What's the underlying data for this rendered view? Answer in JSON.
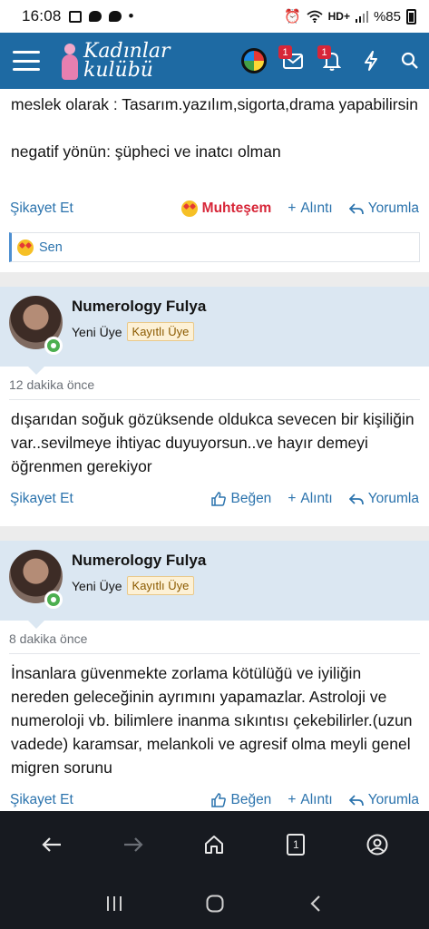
{
  "status": {
    "time": "16:08",
    "network": "HD+",
    "battery": "%85"
  },
  "header": {
    "logo_line1": "Kadınlar",
    "logo_line2": "kulübü",
    "messages_badge": "1",
    "alerts_badge": "1"
  },
  "posts": [
    {
      "text_line1": "meslek olarak : Tasarım.yazılım,sigorta,drama yapabilirsin",
      "text_line2": "negatif yönün: şüpheci ve inatcı olman",
      "report": "Şikayet Et",
      "reaction": "Muhteşem",
      "quote": "Alıntı",
      "reply": "Yorumla",
      "reacted_by": "Sen"
    },
    {
      "author": "Numerology Fulya",
      "title": "Yeni Üye",
      "role": "Kayıtlı Üye",
      "time": "12 dakika önce",
      "text": "dışarıdan soğuk gözüksende oldukca sevecen bir kişiliğin var..sevilmeye ihtiyac duyuyorsun..ve hayır demeyi öğrenmen gerekiyor",
      "report": "Şikayet Et",
      "like": "Beğen",
      "quote": "Alıntı",
      "reply": "Yorumla"
    },
    {
      "author": "Numerology Fulya",
      "title": "Yeni Üye",
      "role": "Kayıtlı Üye",
      "time": "8 dakika önce",
      "text": "İnsanlara güvenmekte zorlama kötülüğü ve iyiliğin nereden geleceğinin ayrımını yapamazlar. Astroloji ve numeroloji vb. bilimlere inanma sıkıntısı çekebilirler.(uzun vadede) karamsar, melankoli ve agresif olma meyli genel migren sorunu",
      "report": "Şikayet Et",
      "like": "Beğen",
      "quote": "Alıntı",
      "reply": "Yorumla"
    }
  ],
  "browser_nav": {
    "tab_count": "1"
  }
}
